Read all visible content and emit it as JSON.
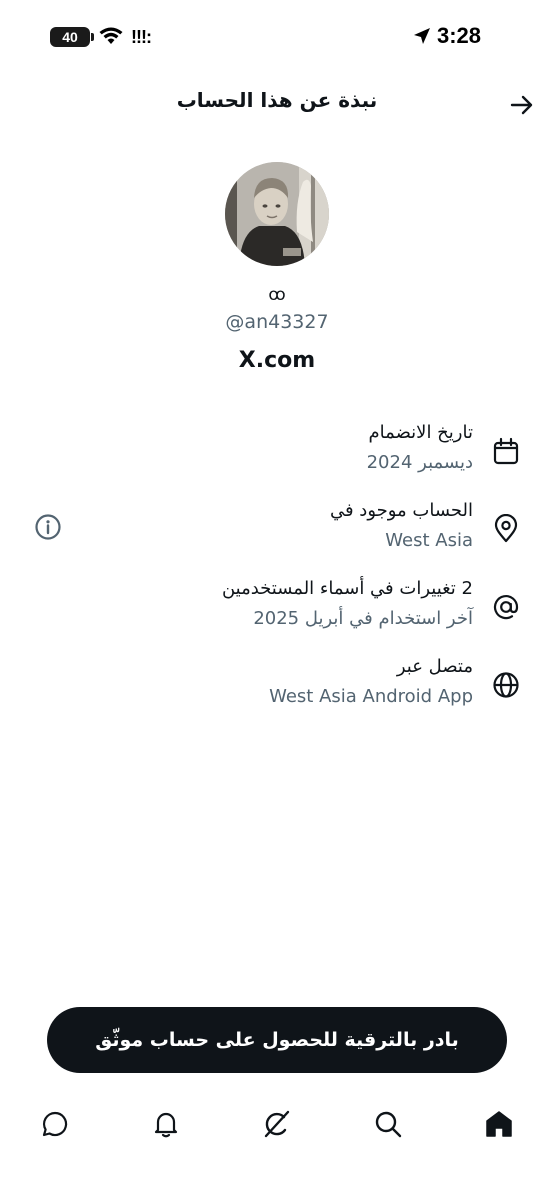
{
  "status_bar": {
    "battery": "40",
    "signal": "!!!:",
    "time": "3:28"
  },
  "header": {
    "title": "نبذة عن هذا الحساب"
  },
  "profile": {
    "display_name": "ꝏ",
    "handle": "@an43327",
    "domain": "X.com"
  },
  "info_rows": [
    {
      "icon": "calendar-icon",
      "title": "تاريخ الانضمام",
      "subtitle": "ديسمبر 2024"
    },
    {
      "icon": "location-pin-icon",
      "title": "الحساب موجود في",
      "subtitle": "West Asia"
    },
    {
      "icon": "at-sign-icon",
      "title": "2 تغييرات في أسماء المستخدمين",
      "subtitle": "آخر استخدام في أبريل 2025"
    },
    {
      "icon": "globe-icon",
      "title": "متصل عبر",
      "subtitle": "West Asia Android App"
    }
  ],
  "upgrade_button": {
    "label": "بادر بالترقية للحصول على حساب موثّق"
  },
  "bottom_nav": [
    "messages-icon",
    "notifications-icon",
    "grok-icon",
    "search-icon",
    "home-icon"
  ],
  "colors": {
    "primary_text": "#0f1419",
    "secondary_text": "#536471",
    "button_bg": "#0f1419"
  }
}
